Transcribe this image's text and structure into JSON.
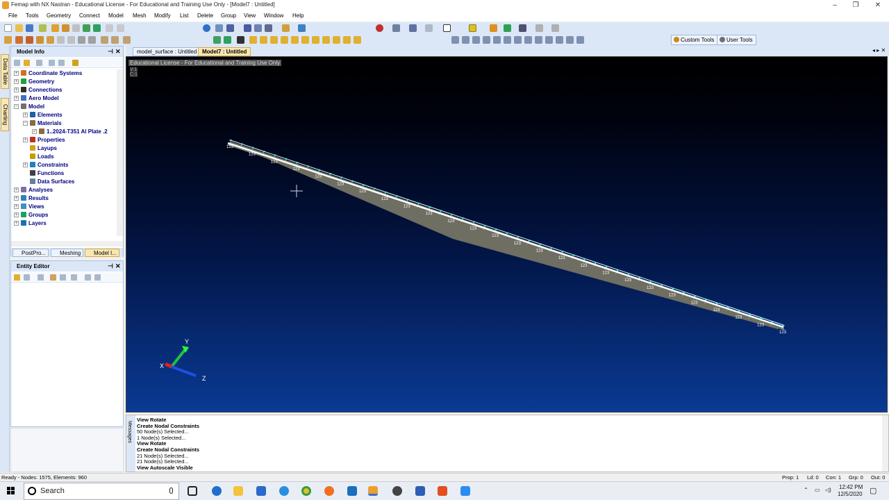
{
  "window": {
    "title": "Femap with NX Nastran - Educational License - For Educational and Training Use Only - [Model7 : Untitled]",
    "controls": {
      "minimize": "–",
      "maximize": "❐",
      "close": "✕"
    }
  },
  "menu": [
    "File",
    "Tools",
    "Geometry",
    "Connect",
    "Model",
    "Mesh",
    "Modify",
    "List",
    "Delete",
    "Group",
    "View",
    "Window",
    "Help"
  ],
  "toolbar": {
    "custom_tools": "Custom Tools",
    "user_tools": "User Tools"
  },
  "left_strip": {
    "data_table": "Data Table",
    "charting": "Charting"
  },
  "model_info": {
    "title": "Model Info",
    "pin": "⊣",
    "close": "✕",
    "tree": [
      {
        "label": "Coordinate Systems",
        "exp": "+",
        "indent": 0,
        "color": "#d07020"
      },
      {
        "label": "Geometry",
        "exp": "+",
        "indent": 0,
        "color": "#20a040"
      },
      {
        "label": "Connections",
        "exp": "+",
        "indent": 0,
        "color": "#303030"
      },
      {
        "label": "Aero Model",
        "exp": "+",
        "indent": 0,
        "color": "#4070c0"
      },
      {
        "label": "Model",
        "exp": "−",
        "indent": 0,
        "color": "#707070"
      },
      {
        "label": "Elements",
        "exp": "+",
        "indent": 1,
        "color": "#2060a0"
      },
      {
        "label": "Materials",
        "exp": "−",
        "indent": 1,
        "color": "#8a6a40"
      },
      {
        "label": "1..2024-T351 Al Plate .2",
        "exp": "✓",
        "indent": 2,
        "color": "#8a6a40"
      },
      {
        "label": "Properties",
        "exp": "+",
        "indent": 1,
        "color": "#c03020"
      },
      {
        "label": "Layups",
        "exp": "",
        "indent": 1,
        "color": "#d8a020"
      },
      {
        "label": "Loads",
        "exp": "",
        "indent": 1,
        "color": "#c0a000"
      },
      {
        "label": "Constraints",
        "exp": "+",
        "indent": 1,
        "color": "#2080c0"
      },
      {
        "label": "Functions",
        "exp": "",
        "indent": 1,
        "color": "#404040"
      },
      {
        "label": "Data Surfaces",
        "exp": "",
        "indent": 1,
        "color": "#6080a0"
      },
      {
        "label": "Analyses",
        "exp": "+",
        "indent": 0,
        "color": "#8070a0"
      },
      {
        "label": "Results",
        "exp": "+",
        "indent": 0,
        "color": "#3080c0"
      },
      {
        "label": "Views",
        "exp": "+",
        "indent": 0,
        "color": "#4090c0"
      },
      {
        "label": "Groups",
        "exp": "+",
        "indent": 0,
        "color": "#20a060"
      },
      {
        "label": "Layers",
        "exp": "+",
        "indent": 0,
        "color": "#2070b0"
      }
    ],
    "bottom_tabs": [
      "PostPro...",
      "Meshing",
      "Model I..."
    ]
  },
  "entity_editor": {
    "title": "Entity Editor",
    "pin": "⊣",
    "close": "✕"
  },
  "viewport": {
    "tabs": [
      "model_surface : Untitled",
      "Model7 : Untitled"
    ],
    "active_tab": 1,
    "license_overlay": "Educational License - For Educational and Training Use Only",
    "vc_label": "V: 1\nC: 1",
    "constraint_code": "123",
    "triad": {
      "y": "Y",
      "x": "X",
      "z": "Z"
    }
  },
  "messages": {
    "title": "Messages",
    "lines": [
      {
        "text": "View Rotate",
        "bold": true
      },
      {
        "text": "Create Nodal Constraints",
        "bold": true
      },
      {
        "text": "50 Node(s) Selected...",
        "bold": false
      },
      {
        "text": "1 Node(s) Selected...",
        "bold": false
      },
      {
        "text": "View Rotate",
        "bold": true
      },
      {
        "text": "Create Nodal Constraints",
        "bold": true
      },
      {
        "text": "21 Node(s) Selected...",
        "bold": false
      },
      {
        "text": "21 Node(s) Selected...",
        "bold": false
      },
      {
        "text": "View Autoscale Visible",
        "bold": true
      }
    ]
  },
  "status": {
    "left": "Ready - Nodes: 1575, Elements: 960",
    "prop": "Prop: 1",
    "ld": "Ld: 0",
    "con": "Con: 1",
    "grp": "Grp: 0",
    "out": "Out: 0"
  },
  "taskbar": {
    "search_label": "Search",
    "time": "12:42 PM",
    "date": "12/5/2020"
  },
  "colors": {
    "panel_header": "#dbe7f7",
    "viewport_top": "#000000",
    "viewport_bottom": "#0a3a94",
    "mesh_fill": "#6e6e62",
    "constraint": "#5fe0e0"
  }
}
